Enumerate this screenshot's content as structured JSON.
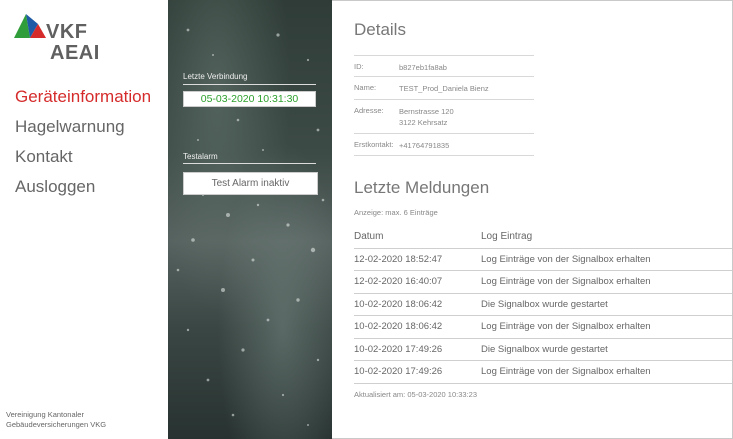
{
  "brand": {
    "line1": "VKF",
    "line2": "AEAI",
    "colors": {
      "green": "#2e9d3a",
      "blue": "#1f5aa6",
      "red": "#d52b2b"
    }
  },
  "nav": {
    "items": [
      {
        "label": "Geräteinformation",
        "active": true
      },
      {
        "label": "Hagelwarnung",
        "active": false
      },
      {
        "label": "Kontakt",
        "active": false
      },
      {
        "label": "Ausloggen",
        "active": false
      }
    ]
  },
  "footer": {
    "line1": "Vereinigung Kantonaler",
    "line2": "Gebäudeversicherungen VKG"
  },
  "status": {
    "connection_label": "Letzte Verbindung",
    "connection_value": "05-03-2020 10:31:30",
    "testalarm_label": "Testalarm",
    "testalarm_button": "Test Alarm inaktiv"
  },
  "details": {
    "title": "Details",
    "id_label": "ID:",
    "id_value": "b827eb1fa8ab",
    "name_label": "Name:",
    "name_value": "TEST_Prod_Daniela Bienz",
    "address_label": "Adresse:",
    "address_line1": "Bernstrasse 120",
    "address_line2": "3122 Kehrsatz",
    "contact_label": "Erstkontakt:",
    "contact_value": "+41764791835"
  },
  "log": {
    "title": "Letzte Meldungen",
    "subtitle": "Anzeige: max. 6 Einträge",
    "col_date": "Datum",
    "col_entry": "Log Eintrag",
    "rows": [
      {
        "date": "12-02-2020 18:52:47",
        "entry": "Log Einträge von der Signalbox erhalten"
      },
      {
        "date": "12-02-2020 16:40:07",
        "entry": "Log Einträge von der Signalbox erhalten"
      },
      {
        "date": "10-02-2020 18:06:42",
        "entry": "Die Signalbox wurde gestartet"
      },
      {
        "date": "10-02-2020 18:06:42",
        "entry": "Log Einträge von der Signalbox erhalten"
      },
      {
        "date": "10-02-2020 17:49:26",
        "entry": "Die Signalbox wurde gestartet"
      },
      {
        "date": "10-02-2020 17:49:26",
        "entry": "Log Einträge von der Signalbox erhalten"
      }
    ],
    "updated": "Aktualisiert am: 05-03-2020 10:33:23"
  }
}
